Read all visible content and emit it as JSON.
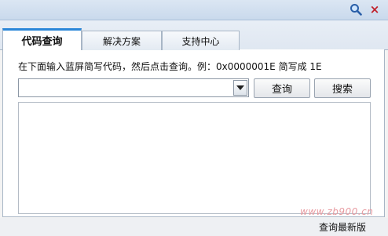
{
  "titlebar": {
    "search_icon": "magnifier-icon",
    "close_icon": "close-icon",
    "close_glyph": "×",
    "accent_color": "#2a86d8"
  },
  "tabs": [
    {
      "label": "代码查询",
      "active": true
    },
    {
      "label": "解决方案",
      "active": false
    },
    {
      "label": "支持中心",
      "active": false
    }
  ],
  "query": {
    "instruction": "在下面输入蓝屏简写代码，然后点击查询。例：0x0000001E 简写成 1E",
    "input_value": "",
    "query_button": "查询",
    "search_button": "搜索",
    "result_text": ""
  },
  "footer": {
    "watermark": "www.zb900.cn",
    "latest_link": "查询最新版"
  }
}
